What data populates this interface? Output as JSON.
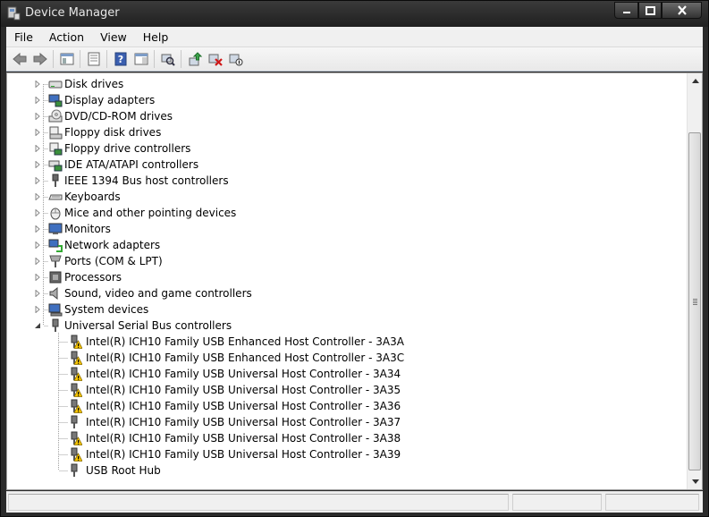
{
  "window": {
    "title": "Device Manager"
  },
  "menu": {
    "items": [
      "File",
      "Action",
      "View",
      "Help"
    ]
  },
  "toolbar": {
    "buttons": [
      "back-icon",
      "forward-icon",
      "show-hide-console-tree-icon",
      "properties-icon",
      "help-icon",
      "action-pane-icon",
      "scan-hardware-icon",
      "update-driver-icon",
      "uninstall-icon",
      "disable-icon"
    ]
  },
  "tree": {
    "categories": [
      {
        "label": "Disk drives",
        "icon": "disk-drive-icon"
      },
      {
        "label": "Display adapters",
        "icon": "display-adapter-icon"
      },
      {
        "label": "DVD/CD-ROM drives",
        "icon": "dvd-drive-icon"
      },
      {
        "label": "Floppy disk drives",
        "icon": "floppy-disk-icon"
      },
      {
        "label": "Floppy drive controllers",
        "icon": "floppy-controller-icon"
      },
      {
        "label": "IDE ATA/ATAPI controllers",
        "icon": "ide-controller-icon"
      },
      {
        "label": "IEEE 1394 Bus host controllers",
        "icon": "ieee1394-icon"
      },
      {
        "label": "Keyboards",
        "icon": "keyboard-icon"
      },
      {
        "label": "Mice and other pointing devices",
        "icon": "mouse-icon"
      },
      {
        "label": "Monitors",
        "icon": "monitor-icon"
      },
      {
        "label": "Network adapters",
        "icon": "network-adapter-icon"
      },
      {
        "label": "Ports (COM & LPT)",
        "icon": "port-icon"
      },
      {
        "label": "Processors",
        "icon": "processor-icon"
      },
      {
        "label": "Sound, video and game controllers",
        "icon": "sound-icon"
      },
      {
        "label": "System devices",
        "icon": "system-device-icon"
      },
      {
        "label": "Universal Serial Bus controllers",
        "icon": "usb-icon"
      }
    ],
    "usb_children": [
      {
        "label": "Intel(R) ICH10 Family USB Enhanced Host Controller - 3A3A",
        "warning": true
      },
      {
        "label": "Intel(R) ICH10 Family USB Enhanced Host Controller - 3A3C",
        "warning": true
      },
      {
        "label": "Intel(R) ICH10 Family USB Universal Host Controller - 3A34",
        "warning": true
      },
      {
        "label": "Intel(R) ICH10 Family USB Universal Host Controller - 3A35",
        "warning": true
      },
      {
        "label": "Intel(R) ICH10 Family USB Universal Host Controller - 3A36",
        "warning": true
      },
      {
        "label": "Intel(R) ICH10 Family USB Universal Host Controller - 3A37",
        "warning": false
      },
      {
        "label": "Intel(R) ICH10 Family USB Universal Host Controller - 3A38",
        "warning": true
      },
      {
        "label": "Intel(R) ICH10 Family USB Universal Host Controller - 3A39",
        "warning": true
      },
      {
        "label": "USB Root Hub",
        "warning": false
      }
    ]
  },
  "colors": {
    "titlebar": "#2b2b2b",
    "warning": "#f5c400",
    "tree_line": "#a0a0a0"
  }
}
